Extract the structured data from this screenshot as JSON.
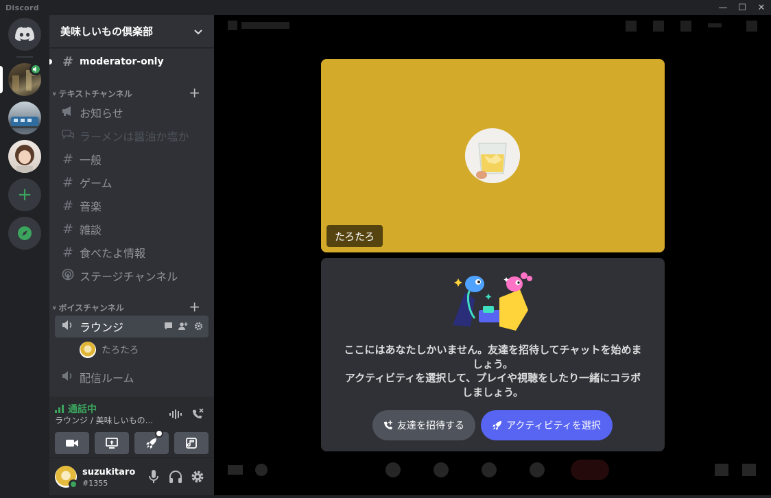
{
  "window": {
    "app_name": "Discord",
    "minimize": "—",
    "maximize": "☐",
    "close": "✕"
  },
  "server": {
    "name": "美味しいもの倶楽部"
  },
  "channels": {
    "top": {
      "label": "moderator-only"
    },
    "text_category": "テキストチャンネル",
    "text_channels": [
      {
        "label": "お知らせ",
        "icon": "announcement-icon"
      },
      {
        "label": "ラーメンは醤油か塩か",
        "icon": "forum-icon"
      },
      {
        "label": "一般",
        "icon": "hash-icon"
      },
      {
        "label": "ゲーム",
        "icon": "hash-icon"
      },
      {
        "label": "音楽",
        "icon": "hash-icon"
      },
      {
        "label": "雑談",
        "icon": "hash-icon"
      },
      {
        "label": "食べたよ情報",
        "icon": "hash-icon"
      },
      {
        "label": "ステージチャンネル",
        "icon": "stage-icon"
      }
    ],
    "voice_category": "ボイスチャンネル",
    "voice_channels": [
      {
        "label": "ラウンジ",
        "icon": "speaker-icon"
      },
      {
        "label": "配信ルーム",
        "icon": "speaker-icon"
      }
    ],
    "voice_user": "たろたろ"
  },
  "voice_connection": {
    "status": "通話中",
    "location": "ラウンジ / 美味しいもの..."
  },
  "user": {
    "name": "suzukitaro",
    "tag": "#1355"
  },
  "stage": {
    "participant_name": "たろたろ",
    "tile_color": "#d4aa2a",
    "invite_message_line1": "ここにはあなたしかいません。友達を招待してチャットを始めましょう。",
    "invite_message_line2": "アクティビティを選択して、プレイや視聴をしたり一緒にコラボしましょう。",
    "invite_button": "友達を招待する",
    "activity_button": "アクティビティを選択"
  },
  "colors": {
    "accent": "#5865f2",
    "online_green": "#3ba55d",
    "sidebar": "#2f3136",
    "rail": "#202225"
  }
}
